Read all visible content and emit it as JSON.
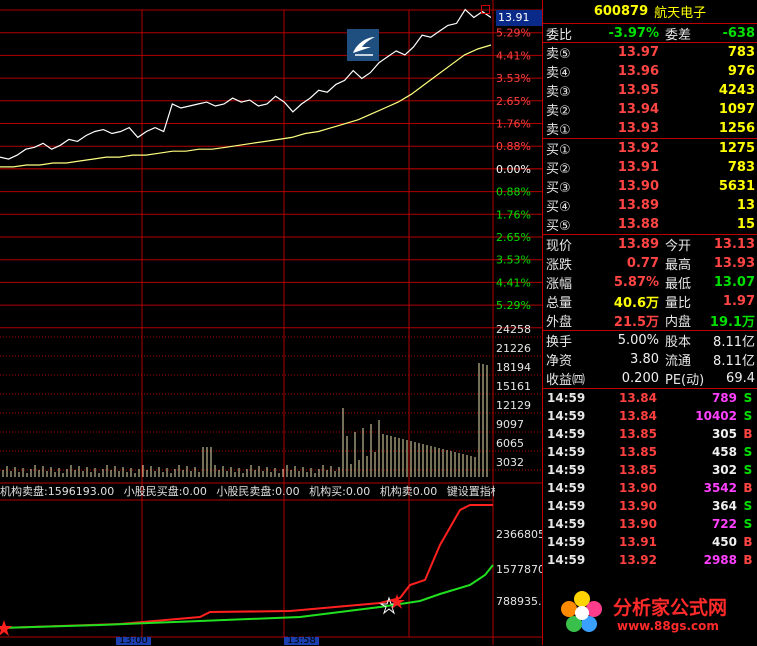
{
  "chart": {
    "current_price_box": "13.91",
    "price_pct_labels": [
      "5.29%",
      "4.41%",
      "3.53%",
      "2.65%",
      "1.76%",
      "0.88%",
      "0.00%",
      "0.88%",
      "1.76%",
      "2.65%",
      "3.53%",
      "4.41%",
      "5.29%"
    ],
    "volume_labels": [
      "24258",
      "21226",
      "18194",
      "15161",
      "12129",
      "9097",
      "6065",
      "3032"
    ],
    "indicator_values": [
      "2366805",
      "1577870",
      "788935.1"
    ],
    "indicator_bar": {
      "items": [
        "机构卖盘:1596193.00",
        "小股民买盘:0.00",
        "小股民卖盘:0.00",
        "机构买:0.00",
        "机构卖0.00",
        "键设置指标"
      ]
    },
    "time_labels": [
      "13:00",
      "13:58"
    ],
    "colors": {
      "grid": "#b00000",
      "up": "#ff3030",
      "down": "#00e000",
      "price_line": "#ffffff",
      "avg_line": "#ffff80",
      "volume": "#e8e0b0"
    }
  },
  "chart_data": {
    "type": "line",
    "title": "",
    "series": [
      {
        "name": "price",
        "values": [
          13.18,
          13.17,
          13.19,
          13.22,
          13.23,
          13.25,
          13.22,
          13.24,
          13.27,
          13.26,
          13.29,
          13.31,
          13.32,
          13.3,
          13.31,
          13.33,
          13.28,
          13.31,
          13.33,
          13.31,
          13.45,
          13.43,
          13.44,
          13.45,
          13.46,
          13.44,
          13.45,
          13.48,
          13.46,
          13.47,
          13.44,
          13.45,
          13.49,
          13.46,
          13.41,
          13.45,
          13.48,
          13.52,
          13.51,
          13.55,
          13.57,
          13.62,
          13.58,
          13.61,
          13.66,
          13.69,
          13.72,
          13.7,
          13.74,
          13.8,
          13.79,
          13.82,
          13.85,
          13.86,
          13.93,
          13.89,
          13.92,
          13.89
        ]
      },
      {
        "name": "avg",
        "values": [
          13.13,
          13.13,
          13.14,
          13.14,
          13.15,
          13.15,
          13.16,
          13.17,
          13.18,
          13.18,
          13.19,
          13.19,
          13.2,
          13.21,
          13.21,
          13.22,
          13.22,
          13.23,
          13.24,
          13.25,
          13.26,
          13.27,
          13.28,
          13.3,
          13.31,
          13.33,
          13.35,
          13.37,
          13.4,
          13.43,
          13.46,
          13.5,
          13.55,
          13.6,
          13.65,
          13.7,
          13.73,
          13.75
        ]
      }
    ],
    "ylim": [
      12.44,
      13.82
    ]
  },
  "panel": {
    "header": {
      "code": "600879",
      "name": "航天电子"
    },
    "weibi": {
      "label": "委比",
      "value": "-3.97%",
      "label2": "委差",
      "value2": "-638"
    },
    "sells": [
      {
        "label": "卖⑤",
        "price": "13.97",
        "vol": "783"
      },
      {
        "label": "卖④",
        "price": "13.96",
        "vol": "976"
      },
      {
        "label": "卖③",
        "price": "13.95",
        "vol": "4243"
      },
      {
        "label": "卖②",
        "price": "13.94",
        "vol": "1097"
      },
      {
        "label": "卖①",
        "price": "13.93",
        "vol": "1256"
      }
    ],
    "buys": [
      {
        "label": "买①",
        "price": "13.92",
        "vol": "1275"
      },
      {
        "label": "买②",
        "price": "13.91",
        "vol": "783"
      },
      {
        "label": "买③",
        "price": "13.90",
        "vol": "5631"
      },
      {
        "label": "买④",
        "price": "13.89",
        "vol": "13"
      },
      {
        "label": "买⑤",
        "price": "13.88",
        "vol": "15"
      }
    ],
    "quote": [
      {
        "l1": "现价",
        "v1": "13.89",
        "l2": "今开",
        "v2": "13.13"
      },
      {
        "l1": "涨跌",
        "v1": "0.77",
        "l2": "最高",
        "v2": "13.93"
      },
      {
        "l1": "涨幅",
        "v1": "5.87%",
        "l2": "最低",
        "v2": "13.07"
      },
      {
        "l1": "总量",
        "v1": "40.6万",
        "l2": "量比",
        "v2": "1.97"
      },
      {
        "l1": "外盘",
        "v1": "21.5万",
        "l2": "内盘",
        "v2": "19.1万"
      }
    ],
    "info": [
      {
        "l1": "换手",
        "v1": "5.00%",
        "l2": "股本",
        "v2": "8.11亿"
      },
      {
        "l1": "净资",
        "v1": "3.80",
        "l2": "流通",
        "v2": "8.11亿"
      },
      {
        "l1": "收益㈣",
        "v1": "0.200",
        "l2": "PE(动)",
        "v2": "69.4"
      }
    ],
    "ticks": [
      {
        "time": "14:59",
        "price": "13.84",
        "vol": "789",
        "dir": "S"
      },
      {
        "time": "14:59",
        "price": "13.84",
        "vol": "10402",
        "dir": "S"
      },
      {
        "time": "14:59",
        "price": "13.85",
        "vol": "305",
        "dir": "B"
      },
      {
        "time": "14:59",
        "price": "13.85",
        "vol": "458",
        "dir": "S"
      },
      {
        "time": "14:59",
        "price": "13.85",
        "vol": "302",
        "dir": "S"
      },
      {
        "time": "14:59",
        "price": "13.90",
        "vol": "3542",
        "dir": "B"
      },
      {
        "time": "14:59",
        "price": "13.90",
        "vol": "364",
        "dir": "S"
      },
      {
        "time": "14:59",
        "price": "13.90",
        "vol": "722",
        "dir": "S"
      },
      {
        "time": "14:59",
        "price": "13.91",
        "vol": "450",
        "dir": "B"
      },
      {
        "time": "14:59",
        "price": "13.92",
        "vol": "2988",
        "dir": "B"
      }
    ]
  },
  "watermark": {
    "text": "分析家公式网",
    "url": "www.88gs.com"
  }
}
